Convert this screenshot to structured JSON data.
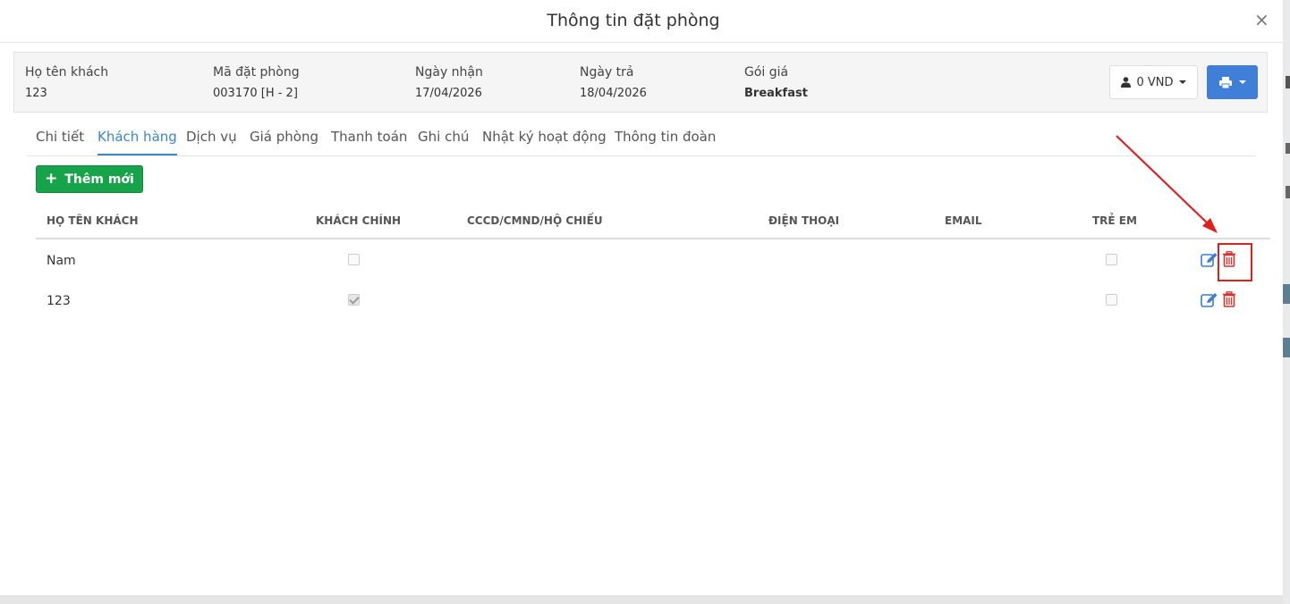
{
  "dialog": {
    "title": "Thông tin đặt phòng",
    "close_symbol": "×"
  },
  "booking_info": {
    "guest_name_label": "Họ tên khách",
    "guest_name": "123",
    "booking_code_label": "Mã đặt phòng",
    "booking_code": "003170 [H - 2]",
    "checkin_label": "Ngày nhận",
    "checkin": "17/04/2026",
    "checkout_label": "Ngày trả",
    "checkout": "18/04/2026",
    "rate_plan_label": "Gói giá",
    "rate_plan": "Breakfast"
  },
  "actions": {
    "balance_label": "0 VND",
    "balance_icon": "user-icon",
    "print_icon": "print-icon"
  },
  "tabs": [
    {
      "label": "Chi tiết",
      "active": false
    },
    {
      "label": "Khách hàng",
      "active": true
    },
    {
      "label": "Dịch vụ",
      "active": false
    },
    {
      "label": "Giá phòng",
      "active": false
    },
    {
      "label": "Thanh toán",
      "active": false
    },
    {
      "label": "Ghi chú",
      "active": false
    },
    {
      "label": "Nhật ký hoạt động",
      "active": false
    },
    {
      "label": "Thông tin đoàn",
      "active": false
    }
  ],
  "add_button": {
    "label": "Thêm mới",
    "color": "#17a349"
  },
  "guest_table": {
    "headers": [
      "HỌ TÊN KHÁCH",
      "KHÁCH CHÍNH",
      "CCCD/CMND/HỘ CHIẾU",
      "ĐIỆN THOẠI",
      "EMAIL",
      "TRẺ EM"
    ],
    "rows": [
      {
        "name": "Nam",
        "main_guest": false,
        "id_number": "",
        "phone": "",
        "email": "",
        "child": false
      },
      {
        "name": "123",
        "main_guest": true,
        "id_number": "",
        "phone": "",
        "email": "",
        "child": false
      }
    ]
  },
  "colors": {
    "accent": "#3a87c8",
    "print_button": "#3f7fd8",
    "edit_icon": "#3a7fd5",
    "delete_icon": "#d9322c",
    "annotation": "#e0201d"
  }
}
